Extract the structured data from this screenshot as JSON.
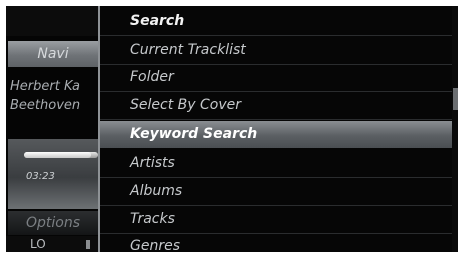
{
  "left_panel": {
    "navi_label": "Navi",
    "artist": "Herbert Ka",
    "album": "Beethoven",
    "elapsed": "03:23",
    "progress_fraction": 0.9,
    "options_label": "Options",
    "lo_label": "LO"
  },
  "menu": {
    "title": "Search",
    "items": [
      "Current Tracklist",
      "Folder",
      "Select By Cover",
      "Keyword Search",
      "Artists",
      "Albums",
      "Tracks",
      "Genres"
    ],
    "selected_item": "Keyword Search"
  },
  "colors": {
    "menu_background": "#060606",
    "selected_highlight": "#6e7276",
    "menu_text": "#c6c9cc",
    "navi_button": "#7f8387"
  }
}
